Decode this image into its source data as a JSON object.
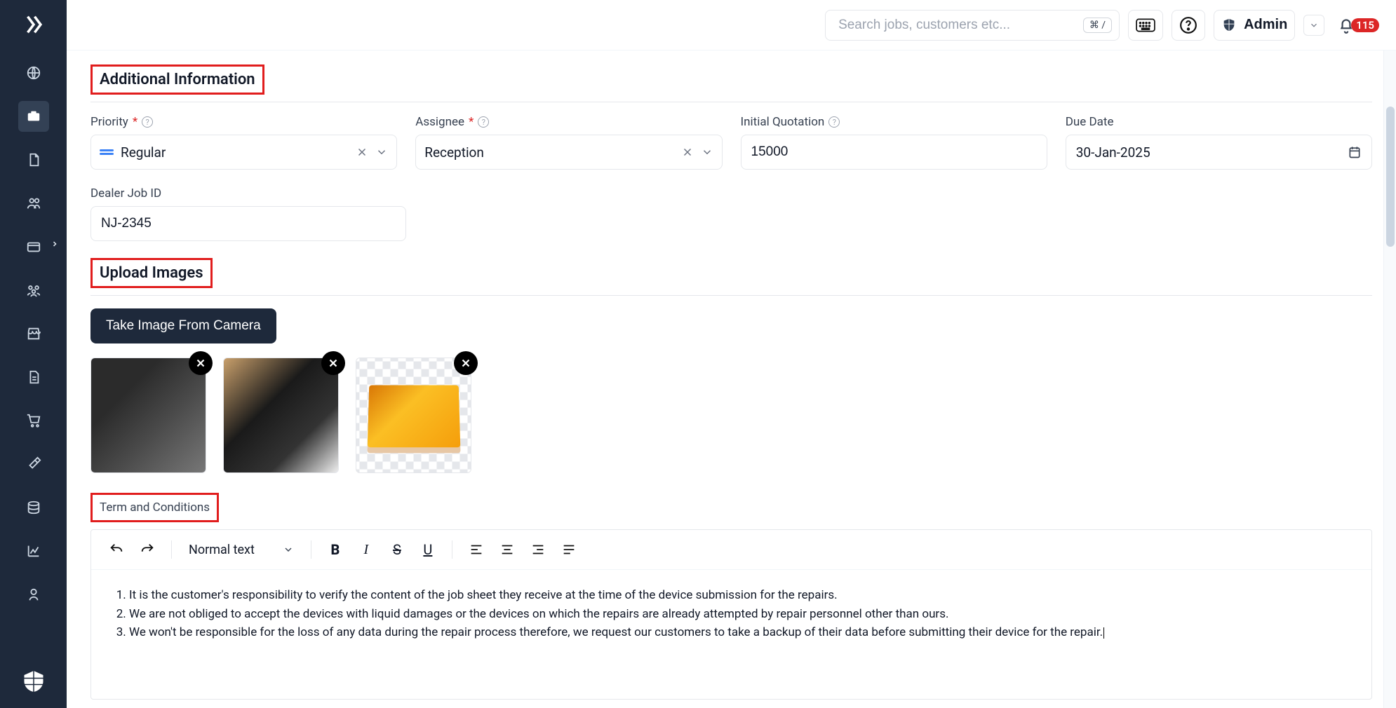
{
  "header": {
    "search_placeholder": "Search jobs, customers etc...",
    "search_shortcut": "⌘ /",
    "user_name": "Admin",
    "notif_count": "115"
  },
  "sections": {
    "additional_info_heading": "Additional Information",
    "upload_images_heading": "Upload Images",
    "terms_heading": "Term and Conditions"
  },
  "form": {
    "priority": {
      "label": "Priority",
      "value": "Regular"
    },
    "assignee": {
      "label": "Assignee",
      "value": "Reception"
    },
    "initial_quotation": {
      "label": "Initial Quotation",
      "value": "15000"
    },
    "due_date": {
      "label": "Due Date",
      "value": "30-Jan-2025"
    },
    "dealer_job_id": {
      "label": "Dealer Job ID",
      "value": "NJ-2345"
    }
  },
  "upload": {
    "camera_button": "Take Image From Camera"
  },
  "editor": {
    "style_label": "Normal text",
    "terms": {
      "t1": "It is the customer's responsibility to verify the content of the job sheet they receive at the time of the device submission for the repairs.",
      "t2": "We are not obliged to accept the devices with liquid damages or the devices on which the repairs are already attempted by repair personnel other than ours.",
      "t3": "We won't be responsible for the loss of any data during the repair process therefore, we request our customers to take a backup of their data before submitting their device for the repair."
    }
  }
}
